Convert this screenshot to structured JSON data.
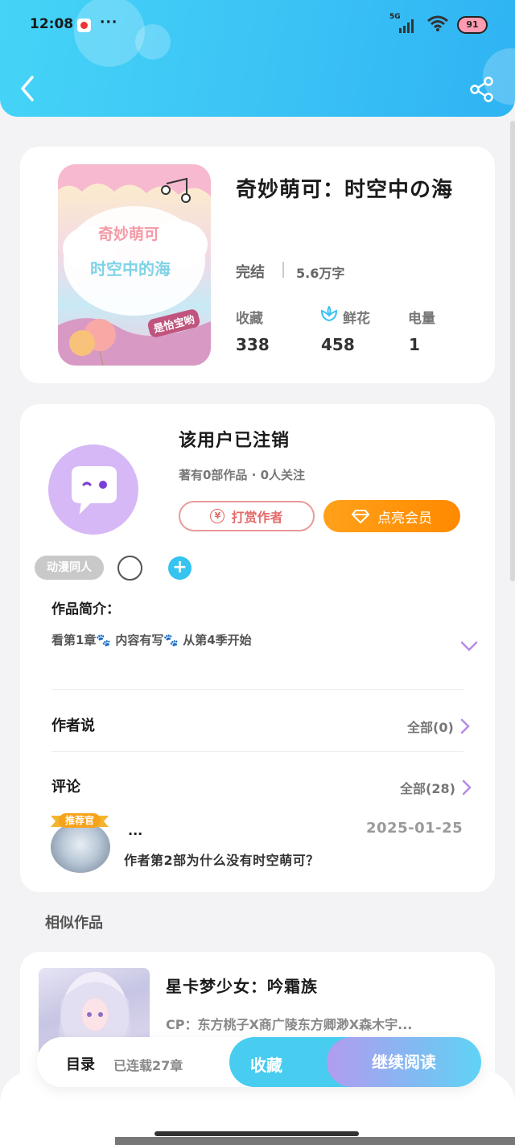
{
  "status_bar": {
    "time": "12:08",
    "dots": "···",
    "network": "5G",
    "battery": "91"
  },
  "book": {
    "title": "奇妙萌可：时空中の海",
    "cover_title_line1": "奇妙萌可",
    "cover_title_line2": "时空中的海",
    "cover_author": "是怡宝哟",
    "status": "完结",
    "word_count": "5.6万字",
    "stats": [
      {
        "label": "收藏",
        "value": "338"
      },
      {
        "label": "鲜花",
        "value": "458"
      },
      {
        "label": "电量",
        "value": "1"
      }
    ]
  },
  "author": {
    "name": "该用户已注销",
    "meta": "著有0部作品 · 0人关注",
    "tip_label": "打赏作者",
    "tip_icon": "¥",
    "vip_label": "点亮会员"
  },
  "tags": {
    "tag": "动漫同人",
    "add": "+"
  },
  "intro": {
    "title": "作品简介：",
    "text": "看第1章🐾 内容有写🐾 从第4季开始"
  },
  "author_says": {
    "title": "作者说",
    "all": "全部(0)"
  },
  "comments": {
    "title": "评论",
    "all": "全部(28)",
    "badge": "推荐官",
    "item": {
      "user": "...",
      "date": "2025-01-25",
      "text": "作者第2部为什么没有时空萌可？"
    }
  },
  "similar": {
    "title": "相似作品",
    "item": {
      "name": "星卡梦少女：吟霜族",
      "cp": "CP：东方桃子X商广陵东方卿渺X森木宇..."
    }
  },
  "bottom_bar": {
    "toc": "目录",
    "chapters": "已连载27章",
    "collect": "收藏",
    "read": "继续阅读"
  },
  "colors": {
    "accent_blue": "#3cc4f5",
    "vip_orange": "#ff9a0f",
    "tip_red": "#e56a6a",
    "avatar_purple": "#d6b8f7"
  }
}
